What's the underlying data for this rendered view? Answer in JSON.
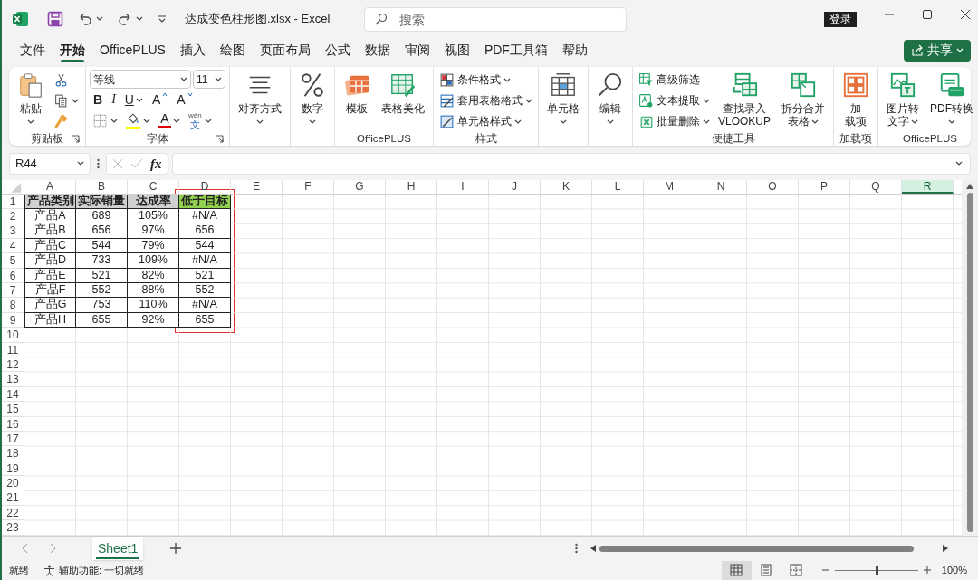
{
  "title_bar": {
    "file_title": "达成变色柱形图.xlsx  -  Excel",
    "search_placeholder": "搜索",
    "login": "登录"
  },
  "menu_tabs": [
    {
      "label": "文件",
      "selected": false
    },
    {
      "label": "开始",
      "selected": true
    },
    {
      "label": "OfficePLUS",
      "selected": false
    },
    {
      "label": "插入",
      "selected": false
    },
    {
      "label": "绘图",
      "selected": false
    },
    {
      "label": "页面布局",
      "selected": false
    },
    {
      "label": "公式",
      "selected": false
    },
    {
      "label": "数据",
      "selected": false
    },
    {
      "label": "审阅",
      "selected": false
    },
    {
      "label": "视图",
      "selected": false
    },
    {
      "label": "PDF工具箱",
      "selected": false
    },
    {
      "label": "帮助",
      "selected": false
    }
  ],
  "share_button": "共享",
  "ribbon": {
    "groups": [
      {
        "label": "剪贴板",
        "launcher": true,
        "columns": [
          {
            "items": [
              {
                "kind": "large",
                "lines": [
                  "粘贴"
                ],
                "caret": true
              }
            ]
          },
          {
            "items": [
              {
                "kind": "icon"
              },
              {
                "kind": "icon",
                "caret": true
              },
              {
                "kind": "icon"
              }
            ]
          }
        ]
      },
      {
        "label": "字体",
        "launcher": true,
        "rows": [
          {
            "items": [
              {
                "kind": "combo",
                "value": "等线"
              },
              {
                "kind": "combo",
                "value": "11"
              }
            ]
          },
          {
            "items": [
              {
                "kind": "glyph",
                "label": "B"
              },
              {
                "kind": "glyph",
                "label": "I"
              },
              {
                "kind": "glyph",
                "label": "U",
                "caret": true
              },
              {
                "kind": "grow",
                "label": "A"
              },
              {
                "kind": "shrink",
                "label": "A"
              }
            ]
          },
          {
            "items": [
              {
                "kind": "icon",
                "caret": true
              },
              {
                "kind": "icon",
                "caret": true,
                "color": "#ffff00"
              },
              {
                "kind": "fontcolor",
                "label": "A",
                "caret": true,
                "color": "#e00000"
              },
              {
                "kind": "phonetic",
                "lines": [
                  "wén",
                  "文"
                ],
                "caret": true
              }
            ]
          }
        ]
      },
      {
        "columns": [
          {
            "items": [
              {
                "kind": "large",
                "lines": [
                  "对齐方式"
                ],
                "caret": true
              }
            ]
          }
        ]
      },
      {
        "columns": [
          {
            "items": [
              {
                "kind": "large",
                "lines": [
                  "数字"
                ],
                "caret": true
              }
            ]
          }
        ]
      },
      {
        "label": "OfficePLUS",
        "columns": [
          {
            "items": [
              {
                "kind": "large",
                "lines": [
                  "模板"
                ]
              }
            ]
          },
          {
            "items": [
              {
                "kind": "large",
                "lines": [
                  "表格美化"
                ]
              }
            ]
          }
        ]
      },
      {
        "label": "样式",
        "columns": [
          {
            "items": [
              {
                "kind": "small",
                "label": "条件格式",
                "caret": true
              },
              {
                "kind": "small",
                "label": "套用表格格式",
                "caret": true
              },
              {
                "kind": "small",
                "label": "单元格样式",
                "caret": true
              }
            ]
          }
        ]
      },
      {
        "columns": [
          {
            "items": [
              {
                "kind": "large",
                "lines": [
                  "单元格"
                ],
                "caret": true
              }
            ]
          }
        ]
      },
      {
        "columns": [
          {
            "items": [
              {
                "kind": "large",
                "lines": [
                  "编辑"
                ],
                "caret": true
              }
            ]
          }
        ]
      },
      {
        "label": "便捷工具",
        "columns": [
          {
            "items": [
              {
                "kind": "small",
                "label": "高级筛选"
              },
              {
                "kind": "small",
                "label": "文本提取",
                "caret": true
              },
              {
                "kind": "small",
                "label": "批量删除",
                "caret": true
              }
            ]
          },
          {
            "items": [
              {
                "kind": "large",
                "lines": [
                  "查找录入",
                  "VLOOKUP"
                ]
              }
            ]
          },
          {
            "items": [
              {
                "kind": "large",
                "lines": [
                  "拆分合并",
                  "表格"
                ],
                "caret": true
              }
            ]
          }
        ]
      },
      {
        "label": "加载项",
        "columns": [
          {
            "items": [
              {
                "kind": "large",
                "lines": [
                  "加",
                  "载项"
                ]
              }
            ]
          }
        ]
      },
      {
        "label": "OfficePLUS",
        "columns": [
          {
            "items": [
              {
                "kind": "large",
                "lines": [
                  "图片转",
                  "文字"
                ],
                "caret": true
              }
            ]
          },
          {
            "items": [
              {
                "kind": "large",
                "lines": [
                  "PDF转换"
                ],
                "caret": true
              }
            ]
          }
        ]
      }
    ]
  },
  "formula_bar": {
    "name_box": "R44",
    "fx": "fx"
  },
  "sheet": {
    "columns": [
      {
        "label": "A",
        "selected": false
      },
      {
        "label": "B",
        "selected": false
      },
      {
        "label": "C",
        "selected": false
      },
      {
        "label": "D",
        "selected": false
      },
      {
        "label": "E",
        "selected": false
      },
      {
        "label": "F",
        "selected": false
      },
      {
        "label": "G",
        "selected": false
      },
      {
        "label": "H",
        "selected": false
      },
      {
        "label": "I",
        "selected": false
      },
      {
        "label": "J",
        "selected": false
      },
      {
        "label": "K",
        "selected": false
      },
      {
        "label": "L",
        "selected": false
      },
      {
        "label": "M",
        "selected": false
      },
      {
        "label": "N",
        "selected": false
      },
      {
        "label": "O",
        "selected": false
      },
      {
        "label": "P",
        "selected": false
      },
      {
        "label": "Q",
        "selected": false
      },
      {
        "label": "R",
        "selected": true
      }
    ],
    "rows": [
      "1",
      "2",
      "3",
      "4",
      "5",
      "6",
      "7",
      "8",
      "9",
      "10",
      "11",
      "12",
      "13",
      "14",
      "15",
      "16",
      "17",
      "18",
      "19",
      "20",
      "21",
      "22",
      "23"
    ],
    "table": {
      "header": [
        {
          "text": "产品类别",
          "color": "#d0d0d0",
          "highlighted": false
        },
        {
          "text": "实际销量",
          "color": "#d0d0d0",
          "highlighted": false
        },
        {
          "text": "达成率",
          "color": "#d0d0d0",
          "highlighted": false
        },
        {
          "text": "低于目标",
          "color": "#92d050",
          "highlighted": true
        }
      ],
      "rows": [
        [
          "产品A",
          "689",
          "105%",
          "#N/A"
        ],
        [
          "产品B",
          "656",
          "97%",
          "656"
        ],
        [
          "产品C",
          "544",
          "79%",
          "544"
        ],
        [
          "产品D",
          "733",
          "109%",
          "#N/A"
        ],
        [
          "产品E",
          "521",
          "82%",
          "521"
        ],
        [
          "产品F",
          "552",
          "88%",
          "552"
        ],
        [
          "产品G",
          "753",
          "110%",
          "#N/A"
        ],
        [
          "产品H",
          "655",
          "92%",
          "655"
        ]
      ]
    }
  },
  "sheet_tabs": [
    {
      "label": "Sheet1",
      "selected": true
    }
  ],
  "status_bar": {
    "ready": "就绪",
    "accessibility": "辅助功能: 一切就绪",
    "views": [
      {
        "selected": true
      },
      {
        "selected": false
      },
      {
        "selected": false
      }
    ],
    "zoom": {
      "level": 0.5,
      "reading": "100%"
    }
  }
}
